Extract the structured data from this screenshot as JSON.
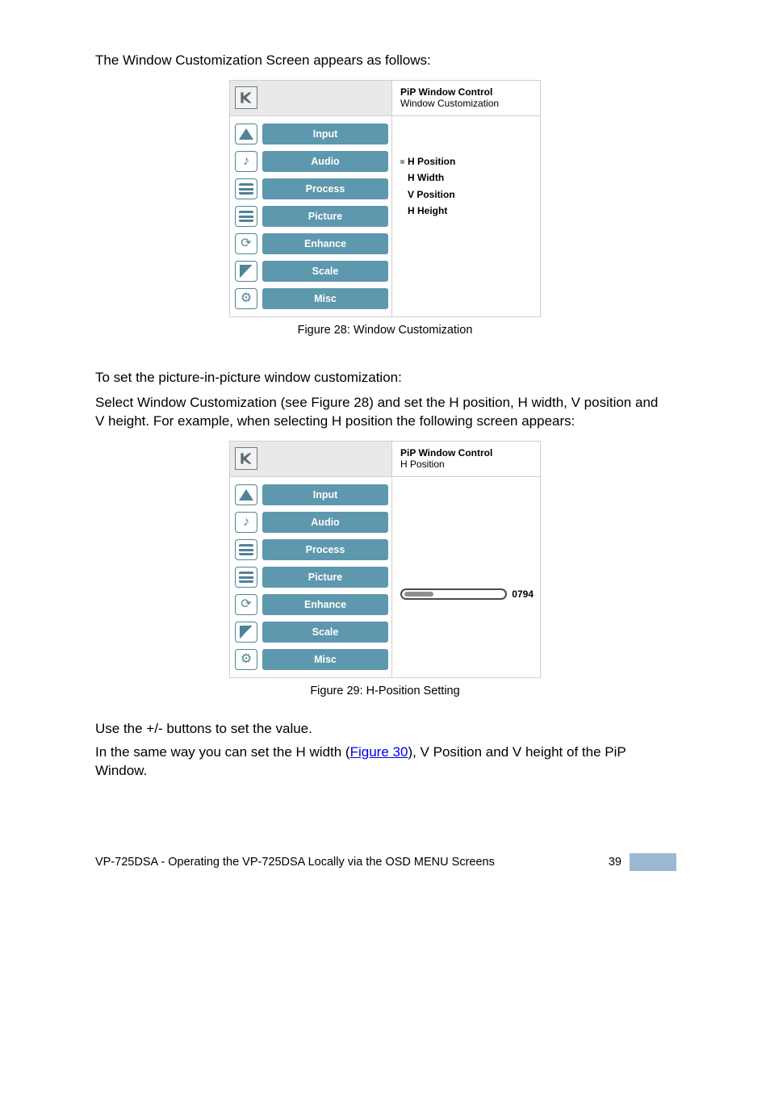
{
  "intro_text": "The Window Customization Screen appears as follows:",
  "figure1": {
    "header_title": "PiP Window Control",
    "header_subtitle": "Window Customization",
    "menu": [
      "Input",
      "Audio",
      "Process",
      "Picture",
      "Enhance",
      "Scale",
      "Misc"
    ],
    "options": [
      {
        "label": "H Position",
        "selected": true
      },
      {
        "label": "H Width",
        "selected": false
      },
      {
        "label": "V Position",
        "selected": false
      },
      {
        "label": "H Height",
        "selected": false
      }
    ],
    "caption_prefix": "Figure 28: Window Customization"
  },
  "section1": {
    "heading": "To set the picture-in-picture window customization:",
    "body": "Select Window Customization (see Figure 28) and set the H position,  H width, V position and V height.  For example, when selecting H position the following screen appears:"
  },
  "figure2": {
    "header_title": "PiP Window Control",
    "header_subtitle": "H Position",
    "menu": [
      "Input",
      "Audio",
      "Process",
      "Picture",
      "Enhance",
      "Scale",
      "Misc"
    ],
    "slider_value": "0794",
    "caption_prefix": "Figure 29: H-Position Setting"
  },
  "section2": {
    "body_line1": "Use the +/- buttons to set the value.",
    "body_line2_prefix": "In the same way you can set the H width (",
    "body_line2_link": "Figure 30",
    "body_line2_suffix": "), V Position and V height  of the PiP Window. "
  },
  "footer": {
    "left_text": "VP-725DSA - Operating the VP-725DSA Locally via the OSD MENU Screens",
    "page_number": "39"
  }
}
